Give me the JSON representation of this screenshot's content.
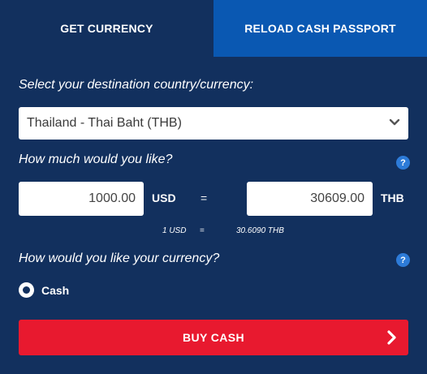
{
  "tabs": {
    "get_currency": "GET CURRENCY",
    "reload_passport": "RELOAD CASH PASSPORT"
  },
  "destination": {
    "label": "Select your destination country/currency:",
    "selected": "Thailand - Thai Baht (THB)",
    "icon": "chevron-down-icon"
  },
  "amount": {
    "label": "How much would you like?",
    "help_icon": "help-icon",
    "help_text": "?",
    "from_value": "1000.00",
    "from_currency": "USD",
    "equals": "=",
    "to_value": "30609.00",
    "to_currency": "THB",
    "rate_from": "1 USD",
    "rate_equals": "=",
    "rate_to": "30.6090 THB"
  },
  "delivery": {
    "label": "How would you like your currency?",
    "help_icon": "help-icon",
    "help_text": "?",
    "option_cash": "Cash",
    "cash_selected": true
  },
  "buy_button": {
    "label": "BUY CASH",
    "icon": "chevron-right-icon"
  },
  "colors": {
    "background": "#12305e",
    "tab_inactive": "#0a58b2",
    "button": "#e8192f",
    "help": "#2d7bd8"
  }
}
